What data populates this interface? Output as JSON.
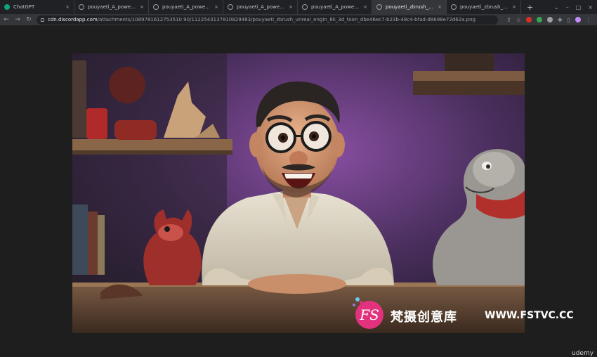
{
  "tabs": [
    {
      "title": "ChatGPT",
      "favicon": "chatgpt-icon",
      "active": false
    },
    {
      "title": "pouyaeti_A_powerful_modern",
      "favicon": "globe-icon",
      "active": false
    },
    {
      "title": "pouyaeti_A_powerful_modern",
      "favicon": "globe-icon",
      "active": false
    },
    {
      "title": "pouyaeti_A_powerful_modern",
      "favicon": "globe-icon",
      "active": false
    },
    {
      "title": "pouyaeti_A_powerful_modern",
      "favicon": "globe-icon",
      "active": false
    },
    {
      "title": "pouyaeti_zbrush_unreal_engi",
      "favicon": "globe-icon",
      "active": true
    },
    {
      "title": "pouyaeti_zbrush_unreal_engi",
      "favicon": "globe-icon",
      "active": false
    }
  ],
  "tab_close_glyph": "×",
  "new_tab_glyph": "+",
  "window_controls": {
    "expand": "⌄",
    "minimize": "–",
    "maximize": "□",
    "close": "×"
  },
  "toolbar": {
    "back": "←",
    "forward": "→",
    "reload": "↻",
    "url_host": "cdn.discordapp.com",
    "url_path": "/attachments/1089781612753510 90/1122543137810829483/pouyaeti_zbrush_unreal_engin_8k_3d_toon_dbe46ec7-b23b-48c4-bfad-d8698e72d62a.png"
  },
  "image": {
    "alt_subject": "cartoon-man-with-glasses-render"
  },
  "watermark": {
    "logo_letters": "FS",
    "chinese": "梵摄创意库",
    "url": "WWW.FSTVC.CC"
  },
  "corner_label": "udemy",
  "colors": {
    "tab_bg": "#202124",
    "toolbar_bg": "#35363a",
    "viewer_bg": "#1e1e1e",
    "watermark_pink": "#e2327d"
  }
}
